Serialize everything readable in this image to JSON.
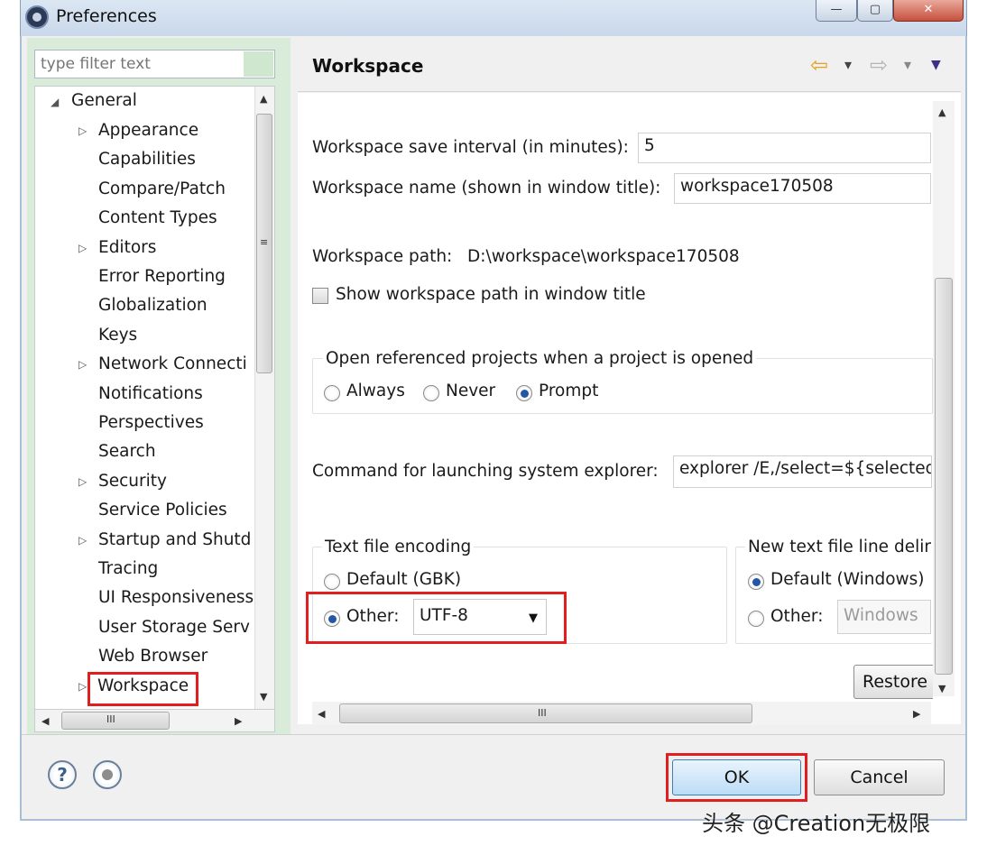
{
  "window": {
    "title": "Preferences",
    "minimize_glyph": "—",
    "maximize_glyph": "▢",
    "close_glyph": "✕"
  },
  "filter": {
    "placeholder": "type filter text"
  },
  "tree": {
    "root": "General",
    "items": [
      {
        "label": "Appearance",
        "expandable": true
      },
      {
        "label": "Capabilities",
        "expandable": false
      },
      {
        "label": "Compare/Patch",
        "expandable": false
      },
      {
        "label": "Content Types",
        "expandable": false
      },
      {
        "label": "Editors",
        "expandable": true
      },
      {
        "label": "Error Reporting",
        "expandable": false
      },
      {
        "label": "Globalization",
        "expandable": false
      },
      {
        "label": "Keys",
        "expandable": false
      },
      {
        "label": "Network Connecti",
        "expandable": true
      },
      {
        "label": "Notifications",
        "expandable": false
      },
      {
        "label": "Perspectives",
        "expandable": false
      },
      {
        "label": "Search",
        "expandable": false
      },
      {
        "label": "Security",
        "expandable": true
      },
      {
        "label": "Service Policies",
        "expandable": false
      },
      {
        "label": "Startup and Shutd",
        "expandable": true
      },
      {
        "label": "Tracing",
        "expandable": false
      },
      {
        "label": "UI Responsiveness",
        "expandable": false
      },
      {
        "label": "User Storage Serv",
        "expandable": false
      },
      {
        "label": "Web Browser",
        "expandable": false
      },
      {
        "label": "Workspace",
        "expandable": true,
        "selected": true
      }
    ],
    "scroll_grip": "≡",
    "hscroll_grip": "III"
  },
  "page": {
    "title": "Workspace",
    "nav": {
      "back_icon": "⇦",
      "forward_icon": "⇨",
      "dropdown_icon": "▾",
      "menu_icon": "▼"
    }
  },
  "workspace": {
    "save_interval_label": "Workspace save interval (in minutes):",
    "save_interval_value": "5",
    "name_label": "Workspace name (shown in window title):",
    "name_value": "workspace170508",
    "path_label": "Workspace path:",
    "path_value": "D:\\workspace\\workspace170508",
    "show_path_label": "Show workspace path in window title",
    "open_projects_title": "Open referenced projects when a project is opened",
    "open_projects_options": [
      "Always",
      "Never",
      "Prompt"
    ],
    "open_projects_selected": "Prompt",
    "explorer_label": "Command for launching system explorer:",
    "explorer_value": "explorer /E,/select=${selected",
    "encoding": {
      "title": "Text file encoding",
      "default_label": "Default (GBK)",
      "other_label": "Other:",
      "other_value": "UTF-8",
      "selected": "Other"
    },
    "line_delimiter": {
      "title": "New text file line delir",
      "default_label": "Default (Windows)",
      "other_label": "Other:",
      "other_value": "Windows",
      "selected": "Default"
    },
    "restore_label": "Restore"
  },
  "buttons": {
    "ok": "OK",
    "cancel": "Cancel",
    "help_icon": "?"
  },
  "watermark": "头条 @Creation无极限",
  "colors": {
    "highlight": "#e02020",
    "radio_selected": "#2456a6",
    "left_pane_bg": "#d9ecd9"
  }
}
